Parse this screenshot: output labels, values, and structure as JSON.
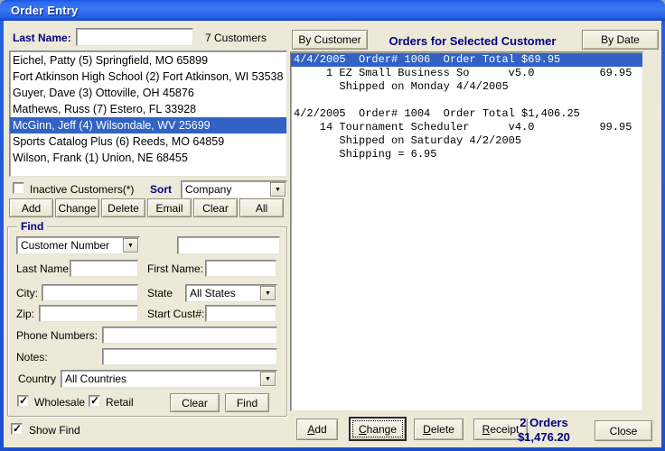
{
  "window": {
    "title": "Order Entry"
  },
  "colors": {
    "titlebar_blue": "#2E6BEF",
    "client_bg": "#ECE9D8",
    "selection_blue": "#3162C4",
    "label_navy": "#000080"
  },
  "customers": {
    "search_label": "Last Name:",
    "search_value": "",
    "count_text": "7 Customers",
    "list": [
      {
        "text": "Eichel, Patty (5) Springfield, MO 65899"
      },
      {
        "text": "Fort Atkinson High School (2) Fort Atkinson, WI 53538"
      },
      {
        "text": "Guyer, Dave (3) Ottoville, OH 45876"
      },
      {
        "text": "Mathews, Russ (7) Estero, FL 33928"
      },
      {
        "text": "McGinn, Jeff (4) Wilsondale, WV 25699"
      },
      {
        "text": "Sports Catalog Plus (6) Reeds, MO 64859"
      },
      {
        "text": "Wilson, Frank (1) Union, NE 68455"
      }
    ],
    "inactive_label": "Inactive Customers(*)",
    "sort_label": "Sort",
    "sort_value": "Company",
    "buttons": [
      "Add",
      "Change",
      "Delete",
      "Email",
      "Clear",
      "All"
    ]
  },
  "find": {
    "title": "Find",
    "search_type_value": "Customer Number",
    "search_value": "",
    "last_name_label": "Last Name:",
    "last_name_value": "",
    "first_name_label": "First Name:",
    "first_name_value": "",
    "city_label": "City:",
    "city_value": "",
    "state_label": "State",
    "state_value": "All States",
    "zip_label": "Zip:",
    "zip_value": "",
    "start_cust_label": "Start Cust#:",
    "start_cust_value": "",
    "phone_label": "Phone Numbers:",
    "phone_value": "",
    "notes_label": "Notes:",
    "notes_value": "",
    "country_label": "Country",
    "country_value": "All Countries",
    "wholesale_label": "Wholesale",
    "retail_label": "Retail",
    "clear_label": "Clear",
    "find_label": "Find"
  },
  "show_find_label": "Show Find",
  "orders": {
    "by_customer_label": "By Customer",
    "title": "Orders for Selected Customer",
    "by_date_label": "By Date",
    "lines": [
      {
        "text": "4/4/2005  Order# 1006  Order Total $69.95"
      },
      {
        "text": "     1 EZ Small Business So      v5.0          69.95"
      },
      {
        "text": "       Shipped on Monday 4/4/2005"
      },
      {
        "text": ""
      },
      {
        "text": "4/2/2005  Order# 1004  Order Total $1,406.25"
      },
      {
        "text": "    14 Tournament Scheduler      v4.0          99.95"
      },
      {
        "text": "       Shipped on Saturday 4/2/2005"
      },
      {
        "text": "       Shipping = 6.95"
      }
    ],
    "buttons": [
      "Add",
      "Change",
      "Delete",
      "Receipt"
    ],
    "count_text": "2 Orders",
    "total_text": "$1,476.20",
    "close_label": "Close"
  }
}
